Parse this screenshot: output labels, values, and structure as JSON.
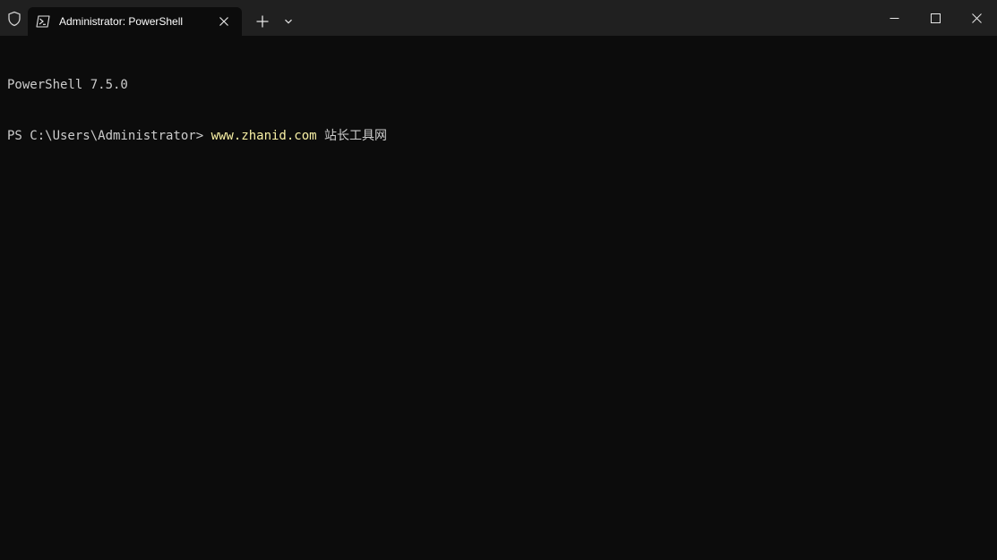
{
  "titlebar": {
    "tab_title": "Administrator: PowerShell",
    "icons": {
      "admin": "shield-icon",
      "tab": "powershell-icon",
      "tab_close": "close-icon",
      "new_tab": "plus-icon",
      "dropdown": "chevron-down-icon",
      "minimize": "minimize-icon",
      "maximize": "maximize-icon",
      "close": "close-icon"
    }
  },
  "terminal": {
    "version_line": "PowerShell 7.5.0",
    "prompt": "PS C:\\Users\\Administrator> ",
    "command": "www.zhanid.com",
    "argument": " 站长工具网"
  },
  "colors": {
    "titlebar_bg": "#202020",
    "terminal_bg": "#0c0c0c",
    "text": "#cccccc",
    "command": "#f9f1a5"
  }
}
